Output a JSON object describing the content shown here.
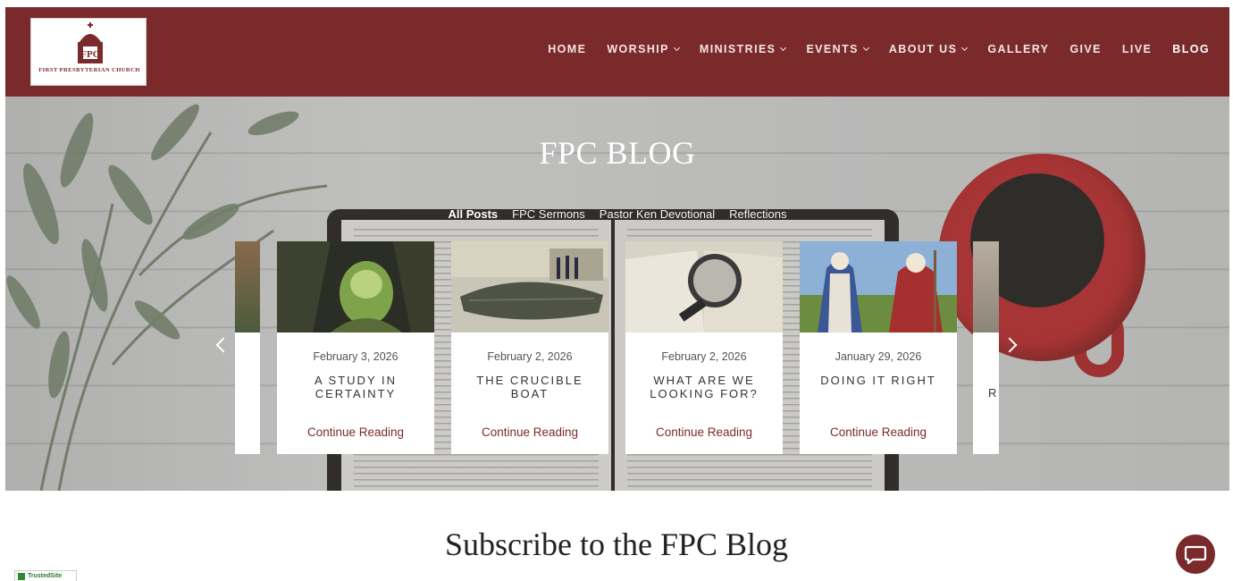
{
  "brand": {
    "logo_letters": "FPC",
    "logo_name": "FIRST PRESBYTERIAN CHURCH",
    "logo_location": "",
    "accent_color": "#7b2a2c"
  },
  "nav": {
    "items": [
      {
        "label": "HOME",
        "has_dropdown": false
      },
      {
        "label": "WORSHIP",
        "has_dropdown": true
      },
      {
        "label": "MINISTRIES",
        "has_dropdown": true
      },
      {
        "label": "EVENTS",
        "has_dropdown": true
      },
      {
        "label": "ABOUT US",
        "has_dropdown": true
      },
      {
        "label": "GALLERY",
        "has_dropdown": false
      },
      {
        "label": "GIVE",
        "has_dropdown": false
      },
      {
        "label": "LIVE",
        "has_dropdown": false
      },
      {
        "label": "BLOG",
        "has_dropdown": false,
        "active": true
      }
    ]
  },
  "hero": {
    "title": "FPC BLOG",
    "filters": [
      "All Posts",
      "FPC Sermons",
      "Pastor Ken Devotional",
      "Reflections"
    ],
    "active_filter": "All Posts"
  },
  "posts": [
    {
      "date": "February 3, 2026",
      "title": "A STUDY IN CERTAINTY",
      "link": "Continue Reading",
      "image": "cave-tunnel"
    },
    {
      "date": "February 2, 2026",
      "title": "THE CRUCIBLE BOAT",
      "link": "Continue Reading",
      "image": "ancient-boat"
    },
    {
      "date": "February 2, 2026",
      "title": "WHAT ARE WE LOOKING FOR?",
      "link": "Continue Reading",
      "image": "magnifying-glass-bible"
    },
    {
      "date": "January 29, 2026",
      "title": "DOING IT RIGHT",
      "link": "Continue Reading",
      "image": "biblical-figures"
    }
  ],
  "partial_next_title_fragment": "R",
  "subscribe": {
    "heading": "Subscribe to the FPC Blog"
  },
  "badge": {
    "label": "TrustedSite"
  },
  "icons": {
    "prev": "chevron-left-icon",
    "next": "chevron-right-icon",
    "chat": "chat-bubble-icon"
  }
}
